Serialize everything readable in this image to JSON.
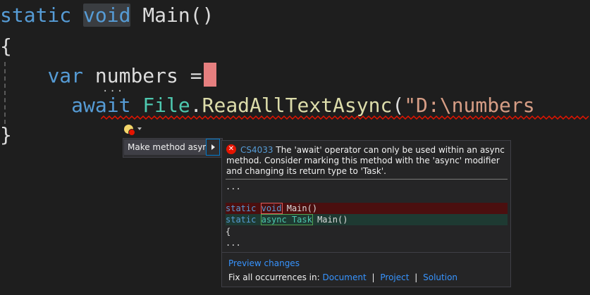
{
  "code": {
    "line1": {
      "kw1": "static",
      "kw2": "void",
      "name": "Main()"
    },
    "line2": {
      "brace": "{"
    },
    "line3": {
      "kw": "var",
      "ident": "numbers",
      "op": "="
    },
    "line4": {
      "kw": "await",
      "type": "File",
      "dot": ".",
      "method": "ReadAllTextAsync",
      "paren": "(",
      "string": "\"D:\\numbers"
    },
    "line5": {
      "brace": "}"
    },
    "ellipsis": "..."
  },
  "quick_actions": {
    "menu_item": "Make method async"
  },
  "preview": {
    "error_code": "CS4033",
    "error_message": "The 'await' operator can only be used within an async method. Consider marking this method with the 'async' modifier and changing its return type to 'Task'.",
    "diff": {
      "top_ellipsis": "...",
      "del": {
        "kw": "static",
        "removed": "void",
        "rest": "Main()"
      },
      "add": {
        "kw": "static",
        "added": "async Task",
        "rest": "Main()"
      },
      "brace": "{",
      "bottom_ellipsis": "..."
    },
    "preview_changes": "Preview changes",
    "fix_all_label": "Fix all occurrences in:",
    "scopes": [
      "Document",
      "Project",
      "Solution"
    ],
    "separator": "|"
  },
  "colors": {
    "background": "#1e1e1e",
    "keyword": "#569cd6",
    "type": "#4ec9b0",
    "method": "#dcdcaa",
    "string": "#d69d85",
    "error": "#e51400",
    "link": "#3794ff"
  }
}
